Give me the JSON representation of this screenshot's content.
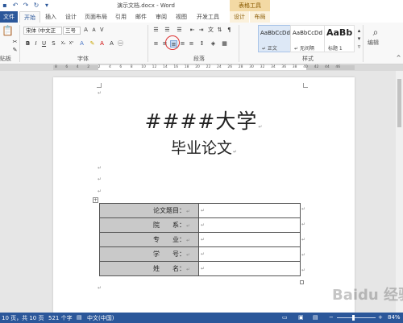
{
  "titlebar": {
    "doc_title": "演示文档.docx - Word",
    "context_title": "表格工具",
    "qat_icons": [
      "save-icon",
      "undo-icon",
      "redo-icon",
      "refresh-icon",
      "customize-icon"
    ]
  },
  "tabs": [
    {
      "label": "文件",
      "kind": "file"
    },
    {
      "label": "开始",
      "kind": "active"
    },
    {
      "label": "插入"
    },
    {
      "label": "设计"
    },
    {
      "label": "页面布局"
    },
    {
      "label": "引用"
    },
    {
      "label": "邮件"
    },
    {
      "label": "审阅"
    },
    {
      "label": "视图"
    },
    {
      "label": "开发工具"
    },
    {
      "label": "设计",
      "kind": "context"
    },
    {
      "label": "布局",
      "kind": "context"
    }
  ],
  "ribbon": {
    "font_name": "宋体 (中文正",
    "font_size": "三号",
    "groups": {
      "clipboard": "贴板",
      "font": "字体",
      "paragraph": "段落",
      "styles": "样式",
      "editing": "编辑"
    },
    "styles": [
      {
        "sample": "AaBbCcDd",
        "name": "↵ 正文"
      },
      {
        "sample": "AaBbCcDd",
        "name": "↵ 无间隔"
      },
      {
        "sample": "AaBb",
        "name": "标题 1"
      }
    ]
  },
  "ruler": {
    "ticks": [
      "8",
      "6",
      "4",
      "2",
      "2",
      "4",
      "6",
      "8",
      "10",
      "12",
      "14",
      "16",
      "18",
      "20",
      "22",
      "24",
      "26",
      "28",
      "30",
      "32",
      "34",
      "36",
      "38",
      "40",
      "42",
      "44",
      "46"
    ]
  },
  "document": {
    "title": "####大学",
    "subtitle": "毕业论文",
    "para_mark": "↵",
    "table": {
      "rows": [
        {
          "label": "论文题目：",
          "value": "↵"
        },
        {
          "label": "院　　系：",
          "value": "↵"
        },
        {
          "label": "专　　业：",
          "value": "↵"
        },
        {
          "label": "学　　号：",
          "value": "↵"
        },
        {
          "label": "姓　　名：",
          "value": "↵"
        }
      ]
    }
  },
  "status": {
    "page": "10 页，共 10 页",
    "words": "521 个字",
    "language": "中文(中国)",
    "zoom": "84%"
  },
  "watermark": "Baidu 经验"
}
